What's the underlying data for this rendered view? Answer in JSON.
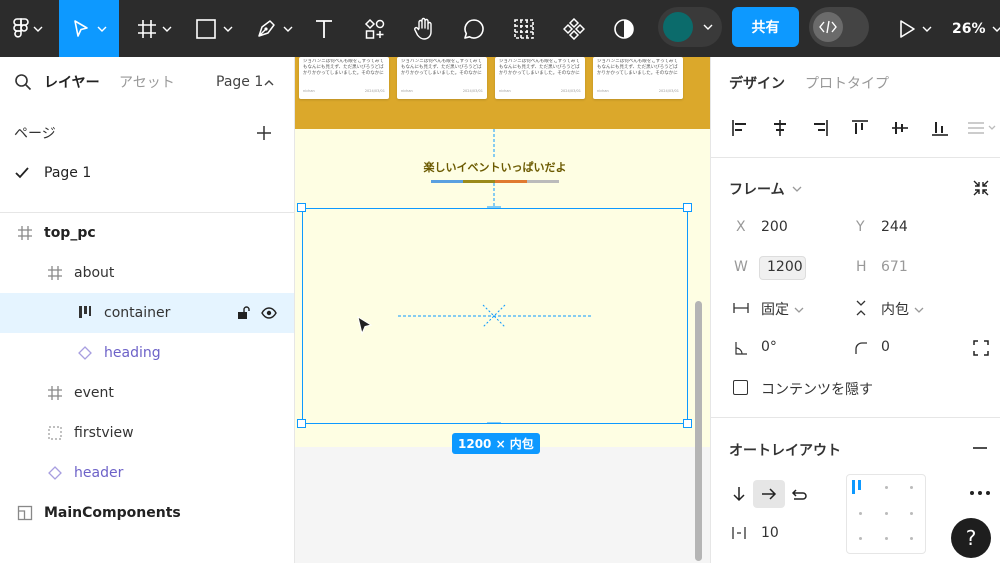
{
  "toolbar": {
    "zoom": "26%",
    "share_label": "共有",
    "fill_color": "#0b6b6b",
    "accent": "#0d99ff"
  },
  "left_panel": {
    "tabs": {
      "layers": "レイヤー",
      "assets": "アセット"
    },
    "page_selector": "Page 1",
    "pages_header": "ページ",
    "pages": [
      "Page 1"
    ],
    "layers": [
      {
        "label": "top_pc",
        "icon": "frame-icon"
      },
      {
        "label": "about",
        "icon": "frame-icon"
      },
      {
        "label": "container",
        "icon": "auto-layout-icon",
        "selected": true
      },
      {
        "label": "heading",
        "icon": "component-instance-icon"
      },
      {
        "label": "event",
        "icon": "frame-icon"
      },
      {
        "label": "firstview",
        "icon": "section-dashed-icon"
      },
      {
        "label": "header",
        "icon": "component-instance-icon"
      },
      {
        "label": "MainComponents",
        "icon": "page-frame-icon"
      }
    ]
  },
  "canvas": {
    "card_text": "ジョバンニは何べんも眼をこすってみてもなんにも見えず、ただ黒いびろうどばかりかかってしまいました。そのなかに",
    "card_author": "nichan",
    "card_dates": [
      "2024/03/01",
      "2024/03/01",
      "2024/03/01",
      "2024/03/01"
    ],
    "event_title": "楽しいイベントいっぱいだよ",
    "size_badge": "1200 × 内包"
  },
  "right_panel": {
    "tabs": {
      "design": "デザイン",
      "prototype": "プロトタイプ"
    },
    "frame_section": "フレーム",
    "x_label": "X",
    "x_value": "200",
    "y_label": "Y",
    "y_value": "244",
    "w_label": "W",
    "w_value": "1200",
    "h_label": "H",
    "h_value": "671",
    "width_mode": "固定",
    "height_mode": "内包",
    "rotation": "0°",
    "radius": "0",
    "clip_content_label": "コンテンツを隠す",
    "auto_layout_section": "オートレイアウト",
    "gap": "10"
  }
}
